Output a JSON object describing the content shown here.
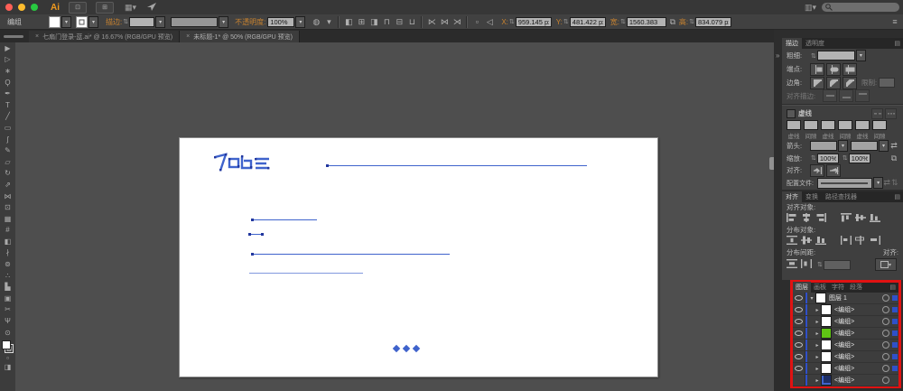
{
  "app": {
    "name_badge": "Ai"
  },
  "titlebar": {
    "window_buttons": [
      "close",
      "minimize",
      "zoom"
    ],
    "left_buttons": [
      {
        "name": "bridge-button",
        "glyph": "⊡"
      },
      {
        "name": "arrange-documents-button",
        "glyph": "⊞"
      }
    ]
  },
  "control_bar": {
    "context_label": "编组",
    "stroke_label": "描边:",
    "opacity_label": "不透明度:",
    "opacity_value": "100%",
    "x_label": "X:",
    "x_value": "959.145 px",
    "y_label": "Y:",
    "y_value": "481.422 px",
    "width_label": "宽:",
    "width_value": "1560.383",
    "height_label": "高:",
    "height_value": "834.079 px",
    "icon_buttons": [
      {
        "name": "style-picker",
        "glyph": "◍"
      },
      {
        "name": "style-options",
        "glyph": "▾"
      },
      {
        "divider": true
      },
      {
        "name": "align-left",
        "glyph": "◧"
      },
      {
        "name": "align-h-center",
        "glyph": "⊞"
      },
      {
        "name": "align-right",
        "glyph": "◨"
      },
      {
        "name": "align-top",
        "glyph": "⊓"
      },
      {
        "name": "align-v-center",
        "glyph": "⊟"
      },
      {
        "name": "align-bottom",
        "glyph": "⊔"
      },
      {
        "divider": true
      },
      {
        "name": "distribute-left",
        "glyph": "⋉"
      },
      {
        "name": "distribute-center",
        "glyph": "⋈"
      },
      {
        "name": "distribute-right",
        "glyph": "⋊"
      },
      {
        "divider": true
      },
      {
        "name": "bounding-box",
        "glyph": "▫"
      },
      {
        "name": "isolate-selected-object",
        "glyph": "◁"
      }
    ]
  },
  "document_tabs": [
    {
      "close": "×",
      "label": "七扇门登录-蓝.ai* @ 16.67% (RGB/GPU 预览)",
      "active": false
    },
    {
      "close": "×",
      "label": "未标题-1* @ 50% (RGB/GPU 预览)",
      "active": true
    }
  ],
  "toolbar": {
    "tools": [
      {
        "name": "selection",
        "glyph": "▶"
      },
      {
        "name": "direct-selection",
        "glyph": "▷"
      },
      {
        "name": "magic-wand",
        "glyph": "∗"
      },
      {
        "name": "lasso",
        "glyph": "Ϙ"
      },
      {
        "name": "pen",
        "glyph": "✒"
      },
      {
        "name": "type",
        "glyph": "T"
      },
      {
        "name": "line-segment",
        "glyph": "╱"
      },
      {
        "name": "rectangle",
        "glyph": "▭"
      },
      {
        "name": "paintbrush",
        "glyph": "ʃ"
      },
      {
        "name": "pencil",
        "glyph": "✎"
      },
      {
        "name": "eraser",
        "glyph": "▱"
      },
      {
        "name": "rotate",
        "glyph": "↻"
      },
      {
        "name": "scale",
        "glyph": "⇗"
      },
      {
        "name": "width",
        "glyph": "⋈"
      },
      {
        "name": "free-transform",
        "glyph": "⊡"
      },
      {
        "name": "perspective-grid",
        "glyph": "▦"
      },
      {
        "name": "mesh",
        "glyph": "#"
      },
      {
        "name": "gradient",
        "glyph": "◧"
      },
      {
        "name": "eyedropper",
        "glyph": "∤"
      },
      {
        "name": "blend",
        "glyph": "⊚"
      },
      {
        "name": "symbol-sprayer",
        "glyph": "∴"
      },
      {
        "name": "column-graph",
        "glyph": "▙"
      },
      {
        "name": "artboard",
        "glyph": "▣"
      },
      {
        "name": "slice",
        "glyph": "✂"
      },
      {
        "name": "hand",
        "glyph": "Ψ"
      },
      {
        "name": "zoom",
        "glyph": "⊙"
      }
    ],
    "bottom_icons": [
      {
        "name": "draw-normal",
        "glyph": "▫"
      },
      {
        "name": "change-screen-mode",
        "glyph": "◨"
      }
    ]
  },
  "stroke_panel": {
    "tabs": [
      "描边",
      "透明度"
    ],
    "weight_label": "粗细:",
    "cap_label": "端点:",
    "corner_label": "边角:",
    "limit_label": "限制:",
    "align_stroke_label": "对齐描边:",
    "dash_section_label": "虚线",
    "dash_field_labels": [
      "虚线",
      "间隙",
      "虚线",
      "间隙",
      "虚线",
      "间隙"
    ],
    "arrow_label": "箭头:",
    "scale_label": "缩放:",
    "scale_values": [
      "100%",
      "100%"
    ],
    "align_label": "对齐:",
    "profile_label": "配置文件:"
  },
  "align_panel": {
    "tabs": [
      "对齐",
      "变换",
      "路径查找器"
    ],
    "align_objects_label": "对齐对象:",
    "distribute_objects_label": "分布对象:",
    "distribute_spacing_label": "分布间距:",
    "align_to_label": "对齐:"
  },
  "layers_panel": {
    "tabs": [
      "图层",
      "画板",
      "字符",
      "段落"
    ],
    "rows": [
      {
        "label": "图层 1",
        "thumb": "white",
        "eye": true,
        "expand": "▾",
        "indent": 0,
        "selected": true
      },
      {
        "label": "<编组>",
        "thumb": "white",
        "eye": true,
        "expand": "▸",
        "indent": 1,
        "selected": true
      },
      {
        "label": "<编组>",
        "thumb": "white",
        "eye": true,
        "expand": "▸",
        "indent": 1,
        "selected": true
      },
      {
        "label": "<编组>",
        "thumb": "green",
        "eye": true,
        "expand": "▸",
        "indent": 1,
        "selected": true
      },
      {
        "label": "<编组>",
        "thumb": "white",
        "eye": true,
        "expand": "▸",
        "indent": 1,
        "selected": true
      },
      {
        "label": "<编组>",
        "thumb": "white",
        "eye": true,
        "expand": "▸",
        "indent": 1,
        "selected": true
      },
      {
        "label": "<编组>",
        "thumb": "white",
        "eye": true,
        "expand": "▸",
        "indent": 1,
        "selected": true
      },
      {
        "label": "<编组>",
        "thumb": "navy",
        "eye": false,
        "expand": "▸",
        "indent": 1,
        "selected": false
      }
    ]
  },
  "colors": {
    "accent_blue": "#3f63cc",
    "highlight_red": "#e01212",
    "layer_green": "#5fc414",
    "selection_blue": "#3050c8"
  }
}
